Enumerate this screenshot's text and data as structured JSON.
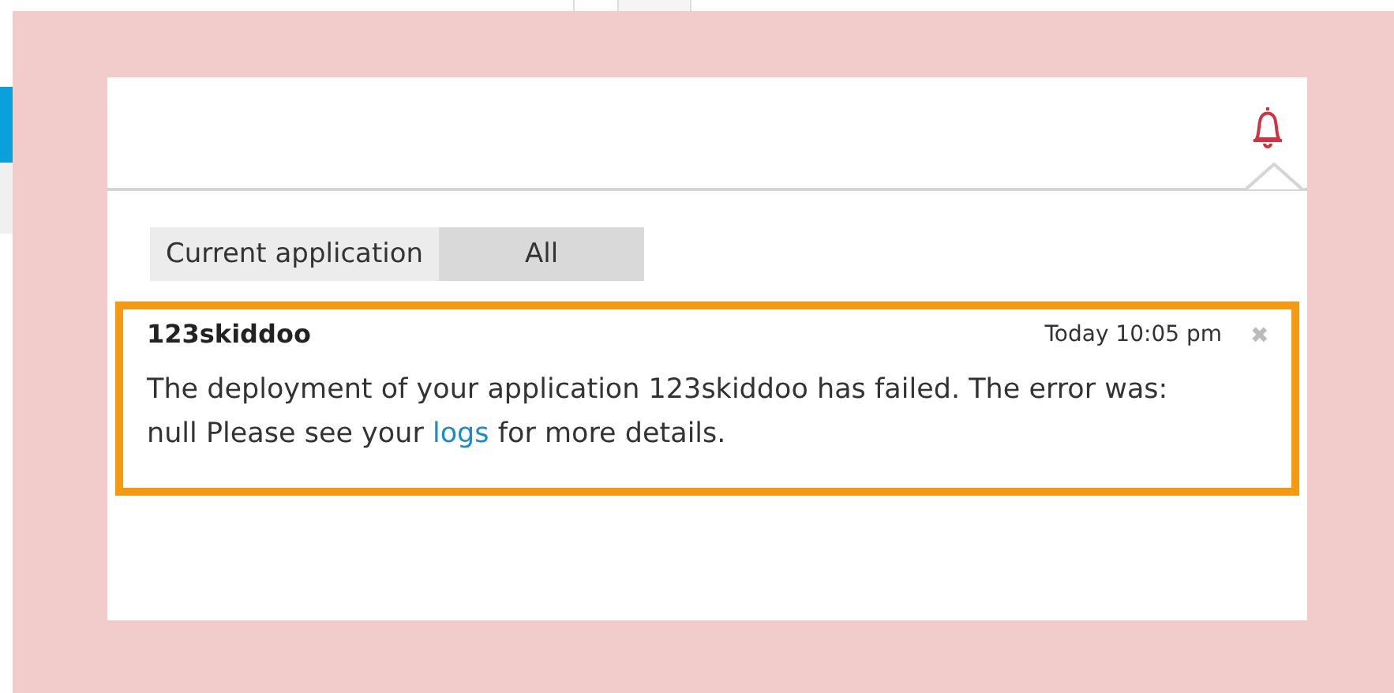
{
  "tabs": [
    {
      "label": "Current application",
      "selected": true
    },
    {
      "label": "All",
      "selected": false
    }
  ],
  "notifications": [
    {
      "app": "123skiddoo",
      "time": "Today 10:05 pm",
      "close": "✖",
      "message_before": "The deployment of your application 123skiddoo has failed. The error was: null Please see your",
      "link": "logs",
      "message_after": "for more details."
    }
  ]
}
